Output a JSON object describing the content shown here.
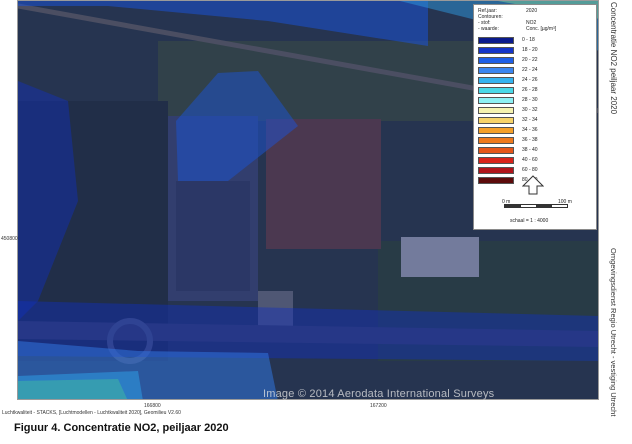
{
  "legend": {
    "meta_keys": [
      "Ref.jaar:",
      "Contouren:",
      "- stof:",
      "- waarde:"
    ],
    "meta_values": [
      "2020",
      "",
      "NO2",
      "Conc. [µg/m³]"
    ],
    "items": [
      {
        "label": "0 - 18",
        "color": "#0a1a8c"
      },
      {
        "label": "18 - 20",
        "color": "#1535c8"
      },
      {
        "label": "20 - 22",
        "color": "#1f5fe6"
      },
      {
        "label": "22 - 24",
        "color": "#3b86f0"
      },
      {
        "label": "24 - 26",
        "color": "#35b3f0"
      },
      {
        "label": "26 - 28",
        "color": "#4ad8e8"
      },
      {
        "label": "28 - 30",
        "color": "#8ef0f5"
      },
      {
        "label": "30 - 32",
        "color": "#f6f2b0"
      },
      {
        "label": "32 - 34",
        "color": "#f7d36a"
      },
      {
        "label": "34 - 36",
        "color": "#f5a02a"
      },
      {
        "label": "36 - 38",
        "color": "#ee7a1e"
      },
      {
        "label": "38 - 40",
        "color": "#e5561a"
      },
      {
        "label": "40 - 60",
        "color": "#d8231a"
      },
      {
        "label": "60 - 80",
        "color": "#b0141a"
      },
      {
        "label": "80 - 99",
        "color": "#5c0a0a"
      }
    ],
    "north_icon": "north-arrow-icon",
    "scale_left": "0 m",
    "scale_right": "100 m",
    "scale_text": "schaal = 1 : 4000"
  },
  "title_vertical": "Concentratie NO2 peiljaar 2020",
  "org_vertical": "Omgevingsdienst Regio Utrecht - vestiging Utrecht",
  "coords": {
    "y_label": "450800",
    "x1": "166800",
    "x2": "167200"
  },
  "credits": "Luchtkwaliteit - STACKS, [Luchtmodellen - Luchtkwaliteit 2020], Geomilieu V2.60",
  "watermark": "Image © 2014 Aerodata International Surveys",
  "caption": "Figuur 4. Concentratie NO2, peiljaar 2020"
}
